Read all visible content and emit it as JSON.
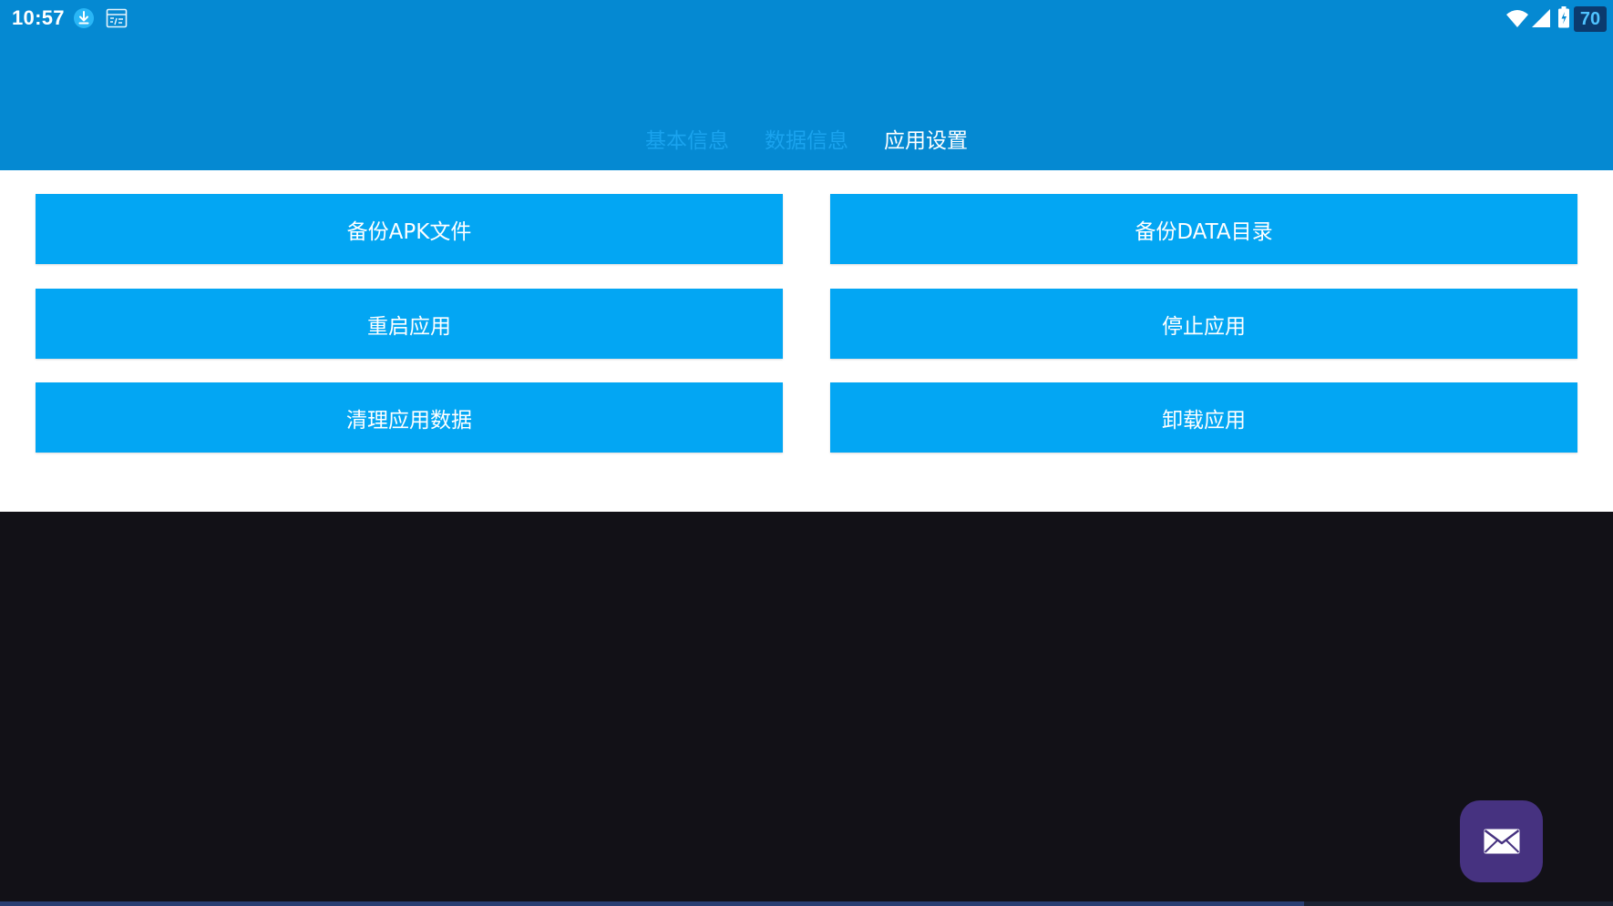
{
  "status_bar": {
    "time": "10:57",
    "battery_percent": "70",
    "icons": [
      "download-icon",
      "sim-card-icon",
      "wifi-icon",
      "cell-signal-icon",
      "battery-charging-icon"
    ]
  },
  "tabs": [
    {
      "label": "基本信息",
      "active": false
    },
    {
      "label": "数据信息",
      "active": false
    },
    {
      "label": "应用设置",
      "active": true
    }
  ],
  "actions": {
    "backup_apk": "备份APK文件",
    "backup_data": "备份DATA目录",
    "restart_app": "重启应用",
    "stop_app": "停止应用",
    "clear_data": "清理应用数据",
    "uninstall_app": "卸载应用"
  },
  "fab": {
    "icon": "mail-icon"
  },
  "colors": {
    "header": "#0589d2",
    "button": "#03a6f3",
    "tab_inactive": "#1aa3ee",
    "tab_active": "#ffffff",
    "fab": "#463280",
    "background": "#121117"
  }
}
